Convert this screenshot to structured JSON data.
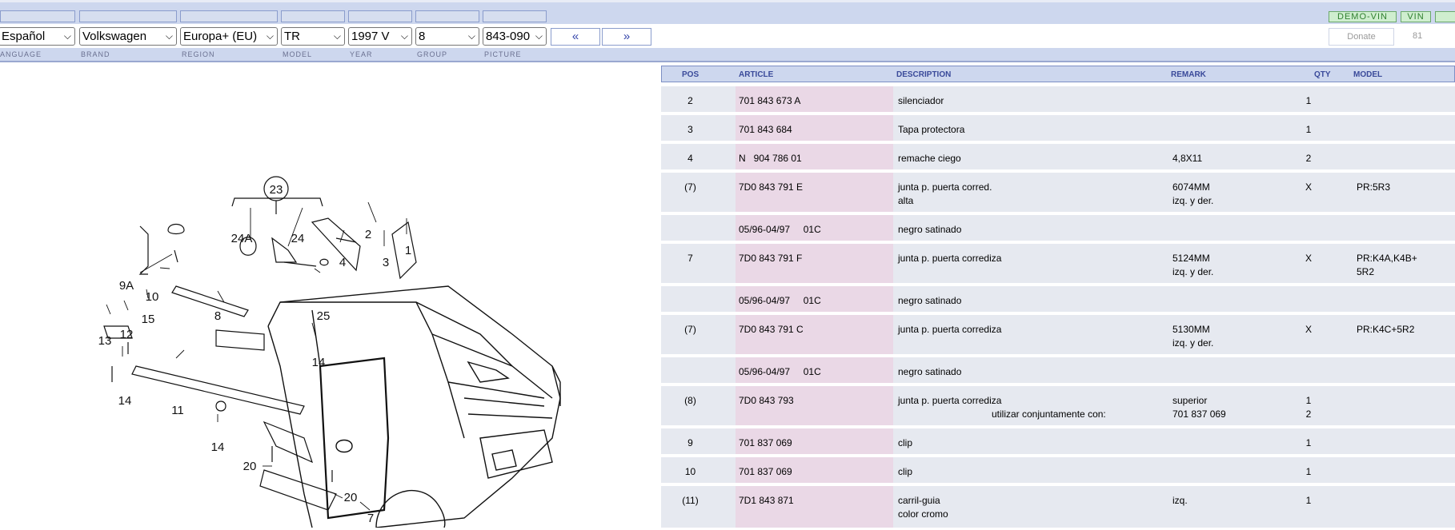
{
  "header": {
    "demo_vin": "DEMO-VIN",
    "vin": "VIN"
  },
  "selectors": {
    "language": "Español",
    "brand": "Volkswagen",
    "region": "Europa+ (EU)",
    "model": "TR",
    "year": "1997  V",
    "group": "8",
    "picture": "843-090",
    "prev": "«",
    "next": "»",
    "donate": "Donate",
    "counter": "81"
  },
  "labels": {
    "language": "LANGUAGE",
    "brand": "BRAND",
    "region": "REGION",
    "model": "MODEL",
    "year": "YEAR",
    "group": "GROUP",
    "picture": "PICTURE"
  },
  "diagram": {
    "callouts": [
      "23",
      "24A",
      "24",
      "2",
      "1",
      "4",
      "3",
      "9A",
      "10",
      "15",
      "8",
      "13",
      "12",
      "25",
      "14",
      "14",
      "11",
      "14",
      "20",
      "20",
      "7"
    ]
  },
  "parts": {
    "columns": {
      "pos": "POS",
      "article": "ARTICLE",
      "description": "DESCRIPTION",
      "remark": "REMARK",
      "qty": "QTY",
      "model": "MODEL"
    },
    "rows": [
      {
        "pos": "2",
        "article": "701 843 673 A",
        "description": "silenciador",
        "remark": "",
        "qty": "1",
        "model": ""
      },
      {
        "pos": "3",
        "article": "701 843 684",
        "description": "Tapa protectora",
        "remark": "",
        "qty": "1",
        "model": ""
      },
      {
        "pos": "4",
        "article": "N   904 786 01",
        "description": "remache ciego",
        "remark": "4,8X11",
        "qty": "2",
        "model": ""
      },
      {
        "pos": "(7)",
        "article": "7D0 843 791 E",
        "description": "junta p. puerta corred.\nalta",
        "remark": "6074MM\nizq. y der.",
        "qty": "X",
        "model": "PR:5R3"
      },
      {
        "pos": "",
        "article": "05/96-04/97     01C",
        "description": "negro satinado",
        "remark": "",
        "qty": "",
        "model": ""
      },
      {
        "pos": "7",
        "article": "7D0 843 791 F",
        "description": "junta p. puerta corrediza",
        "remark": "5124MM\nizq. y der.",
        "qty": "X",
        "model": "PR:K4A,K4B+\n5R2"
      },
      {
        "pos": "",
        "article": "05/96-04/97     01C",
        "description": "negro satinado",
        "remark": "",
        "qty": "",
        "model": ""
      },
      {
        "pos": "(7)",
        "article": "7D0 843 791 C",
        "description": "junta p. puerta corrediza",
        "remark": "5130MM\nizq. y der.",
        "qty": "X",
        "model": "PR:K4C+5R2"
      },
      {
        "pos": "",
        "article": "05/96-04/97     01C",
        "description": "negro satinado",
        "remark": "",
        "qty": "",
        "model": ""
      },
      {
        "pos": "(8)",
        "article": "7D0 843 793",
        "description": "junta p. puerta corrediza",
        "remark": "superior\n701 837 069",
        "qty": "1\n2",
        "model": "",
        "use_with": "utilizar conjuntamente con:"
      },
      {
        "pos": "9",
        "article": "701 837 069",
        "description": "clip",
        "remark": "",
        "qty": "1",
        "model": ""
      },
      {
        "pos": "10",
        "article": "701 837 069",
        "description": "clip",
        "remark": "",
        "qty": "1",
        "model": ""
      },
      {
        "pos": "(11)",
        "article": "7D1 843 871",
        "description": "carril-guia\ncolor cromo",
        "remark": "izq.",
        "qty": "1",
        "model": ""
      }
    ]
  },
  "colors": {
    "header_bg": "#cdd7ee",
    "row_bg": "#e6e9f0",
    "article_bg": "#ead8e6",
    "header_text": "#3a4a9a",
    "vin_green": "#2f7f2f"
  }
}
